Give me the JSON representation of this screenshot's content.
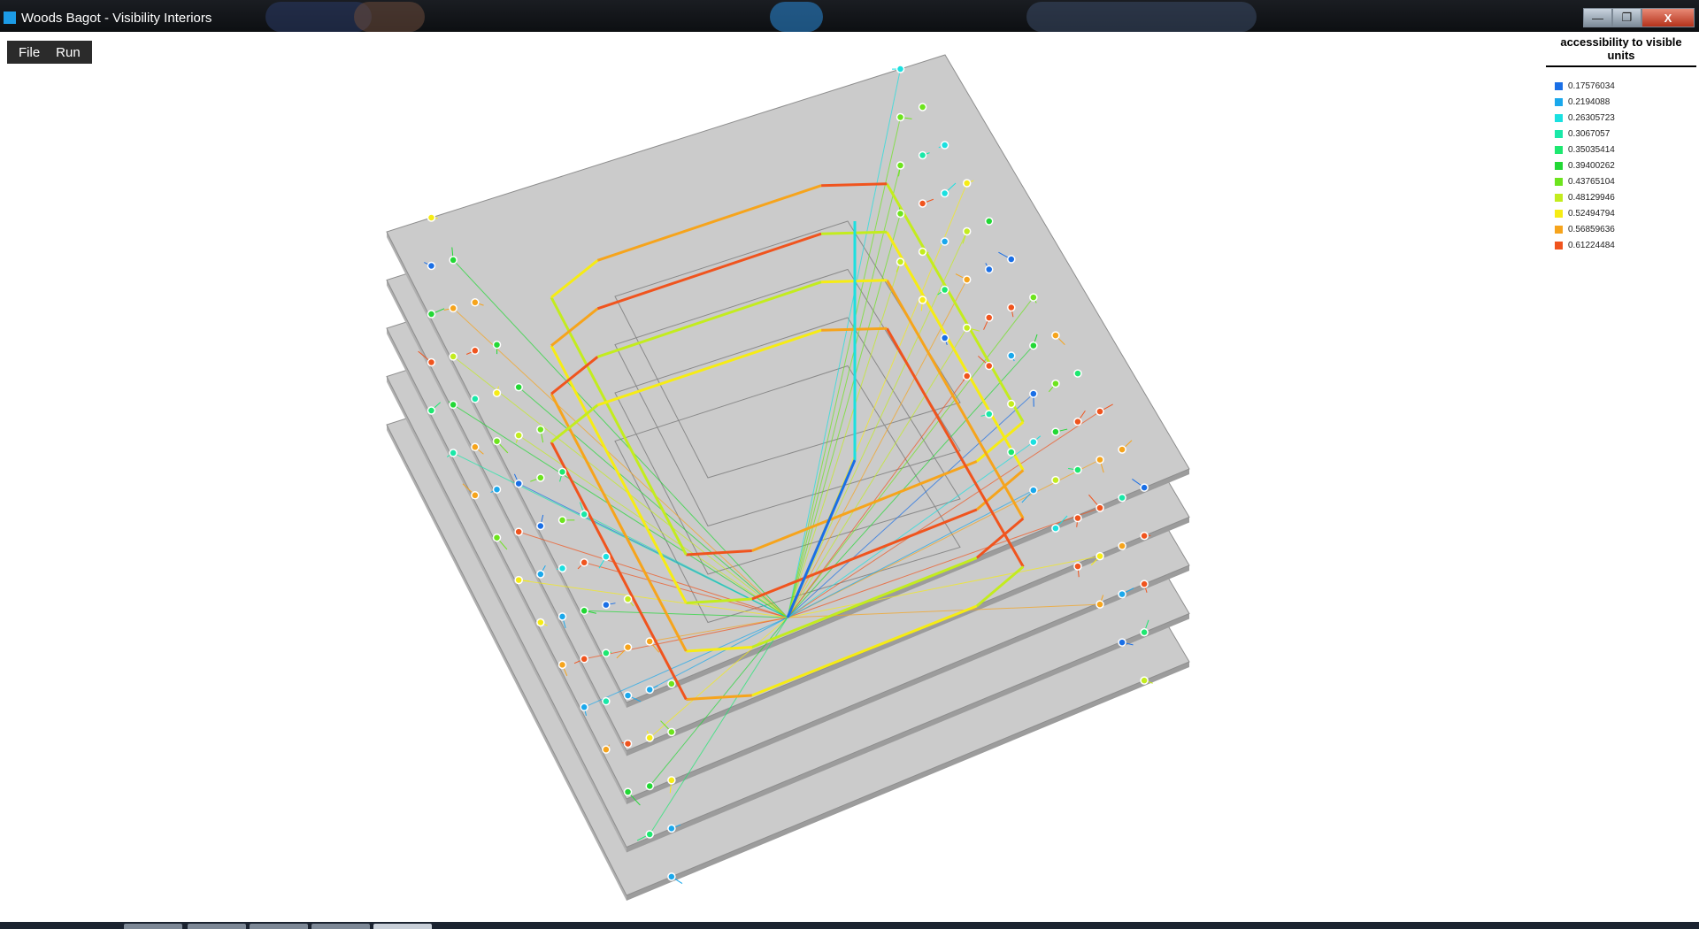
{
  "window": {
    "title": "Woods Bagot - Visibility Interiors",
    "buttons": {
      "minimize": "—",
      "maximize": "❐",
      "close": "X"
    }
  },
  "menu": {
    "items": [
      "File",
      "Run"
    ]
  },
  "legend": {
    "title": "accessibility to visible units",
    "items": [
      {
        "label": "0.17576034",
        "color": "#1a6fe6"
      },
      {
        "label": "0.2194088",
        "color": "#1aa8ec"
      },
      {
        "label": "0.26305723",
        "color": "#1ae0e0"
      },
      {
        "label": "0.3067057",
        "color": "#1ae8a8"
      },
      {
        "label": "0.35035414",
        "color": "#1de870"
      },
      {
        "label": "0.39400262",
        "color": "#22d835"
      },
      {
        "label": "0.43765104",
        "color": "#6de41e"
      },
      {
        "label": "0.48129946",
        "color": "#c3ec1e"
      },
      {
        "label": "0.52494794",
        "color": "#f6ec14"
      },
      {
        "label": "0.56859636",
        "color": "#f6a41c"
      },
      {
        "label": "0.61224484",
        "color": "#f0541e"
      }
    ]
  }
}
